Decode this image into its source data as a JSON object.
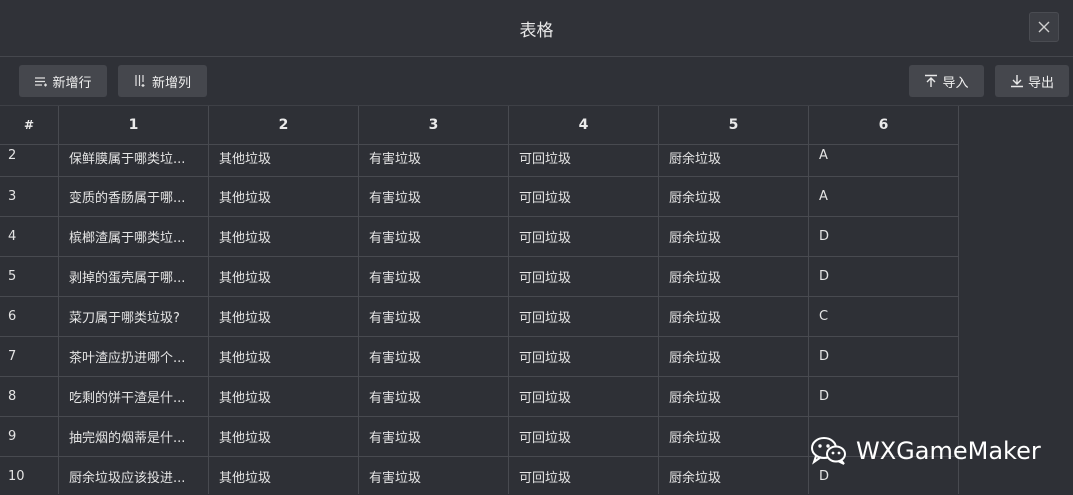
{
  "window": {
    "title": "表格"
  },
  "toolbar": {
    "add_row_label": "新增行",
    "add_col_label": "新增列",
    "import_label": "导入",
    "export_label": "导出"
  },
  "table": {
    "headers": [
      "#",
      "1",
      "2",
      "3",
      "4",
      "5",
      "6"
    ],
    "rows": [
      [
        "2",
        "保鲜膜属于哪类垃...",
        "其他垃圾",
        "有害垃圾",
        "可回垃圾",
        "厨余垃圾",
        "A"
      ],
      [
        "3",
        "变质的香肠属于哪...",
        "其他垃圾",
        "有害垃圾",
        "可回垃圾",
        "厨余垃圾",
        "A"
      ],
      [
        "4",
        "槟榔渣属于哪类垃...",
        "其他垃圾",
        "有害垃圾",
        "可回垃圾",
        "厨余垃圾",
        "D"
      ],
      [
        "5",
        "剥掉的蛋壳属于哪...",
        "其他垃圾",
        "有害垃圾",
        "可回垃圾",
        "厨余垃圾",
        "D"
      ],
      [
        "6",
        "菜刀属于哪类垃圾?",
        "其他垃圾",
        "有害垃圾",
        "可回垃圾",
        "厨余垃圾",
        "C"
      ],
      [
        "7",
        "茶叶渣应扔进哪个...",
        "其他垃圾",
        "有害垃圾",
        "可回垃圾",
        "厨余垃圾",
        "D"
      ],
      [
        "8",
        "吃剩的饼干渣是什...",
        "其他垃圾",
        "有害垃圾",
        "可回垃圾",
        "厨余垃圾",
        "D"
      ],
      [
        "9",
        "抽完烟的烟蒂是什...",
        "其他垃圾",
        "有害垃圾",
        "可回垃圾",
        "厨余垃圾",
        ""
      ],
      [
        "10",
        "厨余垃圾应该投进...",
        "其他垃圾",
        "有害垃圾",
        "可回垃圾",
        "厨余垃圾",
        "D"
      ]
    ]
  },
  "watermark": {
    "text": "WXGameMaker",
    "icon": "wechat-icon"
  }
}
